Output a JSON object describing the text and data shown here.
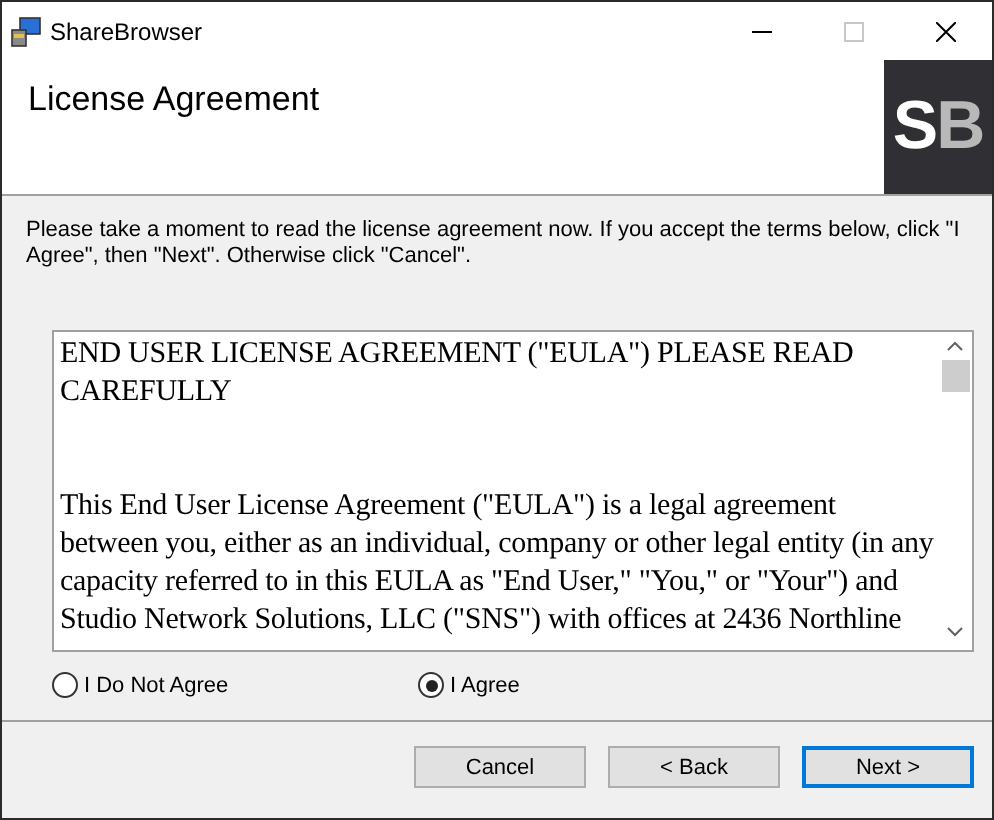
{
  "window": {
    "title": "ShareBrowser",
    "maximize_disabled": true
  },
  "header": {
    "title": "License Agreement",
    "logo": {
      "first": "S",
      "second": "B"
    }
  },
  "intro": "Please take a moment to read the license agreement now. If you accept the terms below, click \"I Agree\", then \"Next\". Otherwise click \"Cancel\".",
  "license": {
    "paragraphs": [
      "END USER LICENSE AGREEMENT (\"EULA\") PLEASE READ CAREFULLY",
      "This End User License Agreement (\"EULA\") is a legal agreement between you, either as an individual, company or other legal entity (in any capacity referred to in this EULA as \"End User,\" \"You,\" or \"Your\") and Studio Network Solutions, LLC (\"SNS\") with offices at 2436 Northline"
    ]
  },
  "options": [
    {
      "label": "I Do Not Agree",
      "selected": false
    },
    {
      "label": "I Agree",
      "selected": true
    }
  ],
  "buttons": [
    {
      "label": "Cancel",
      "default": false
    },
    {
      "label": "< Back",
      "default": false
    },
    {
      "label": "Next >",
      "default": true
    }
  ]
}
